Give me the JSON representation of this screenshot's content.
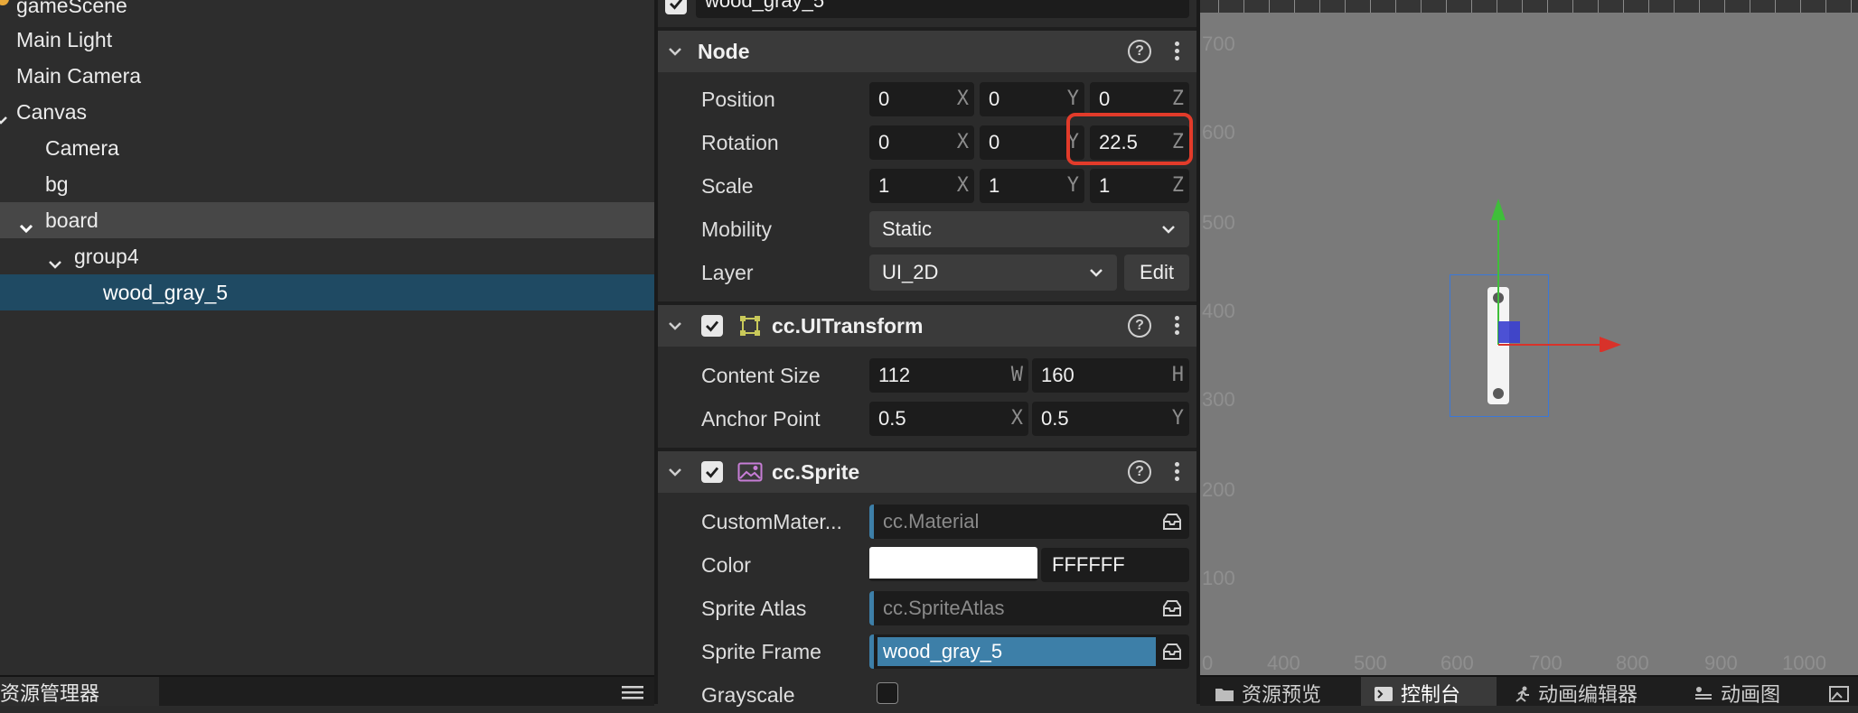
{
  "hierarchy": {
    "items": [
      {
        "label": "gameScene"
      },
      {
        "label": "Main Light"
      },
      {
        "label": "Main Camera"
      },
      {
        "label": "Canvas"
      },
      {
        "label": "Camera"
      },
      {
        "label": "bg"
      },
      {
        "label": "board"
      },
      {
        "label": "group4"
      },
      {
        "label": "wood_gray_5"
      }
    ]
  },
  "assets_panel": {
    "tab_label": "资源管理器"
  },
  "inspector": {
    "node_name": "wood_gray_5",
    "node_section": {
      "title": "Node",
      "position": {
        "label": "Position",
        "x": "0",
        "y": "0",
        "z": "0"
      },
      "rotation": {
        "label": "Rotation",
        "x": "0",
        "y": "0",
        "z": "22.5"
      },
      "scale": {
        "label": "Scale",
        "x": "1",
        "y": "1",
        "z": "1"
      },
      "mobility": {
        "label": "Mobility",
        "value": "Static"
      },
      "layer": {
        "label": "Layer",
        "value": "UI_2D",
        "edit_label": "Edit"
      }
    },
    "uitransform": {
      "title": "cc.UITransform",
      "content_size": {
        "label": "Content Size",
        "w": "112",
        "h": "160"
      },
      "anchor_point": {
        "label": "Anchor Point",
        "x": "0.5",
        "y": "0.5"
      }
    },
    "sprite": {
      "title": "cc.Sprite",
      "custom_material": {
        "label": "CustomMater...",
        "placeholder": "cc.Material"
      },
      "color": {
        "label": "Color",
        "hex": "FFFFFF",
        "swatch": "#ffffff"
      },
      "sprite_atlas": {
        "label": "Sprite Atlas",
        "placeholder": "cc.SpriteAtlas"
      },
      "sprite_frame": {
        "label": "Sprite Frame",
        "value": "wood_gray_5"
      },
      "grayscale": {
        "label": "Grayscale"
      }
    },
    "axis_letters": {
      "x": "X",
      "y": "Y",
      "z": "Z",
      "w": "W",
      "h": "H"
    }
  },
  "scene": {
    "y_labels": [
      "700",
      "600",
      "500",
      "400",
      "300",
      "200",
      "100"
    ],
    "x_labels": [
      "0",
      "400",
      "500",
      "600",
      "700",
      "800",
      "900",
      "1000"
    ]
  },
  "bottom_tabs": [
    {
      "label": "资源预览"
    },
    {
      "label": "控制台"
    },
    {
      "label": "动画编辑器"
    },
    {
      "label": "动画图"
    }
  ],
  "colors": {
    "selection": "#1f4a63",
    "highlight_box": "#e23b2a",
    "asset_accent": "#3d7fa8",
    "gizmo_x": "#d8322a",
    "gizmo_y": "#3fbe3a",
    "gizmo_z": "#3a3fd0"
  }
}
